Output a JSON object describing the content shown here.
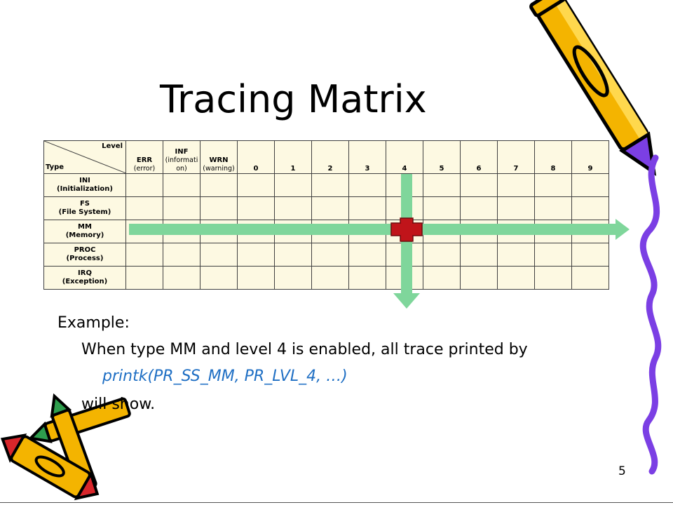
{
  "slide": {
    "title": "Tracing Matrix",
    "page_number": "5"
  },
  "matrix": {
    "corner_level": "Level",
    "corner_type": "Type",
    "columns": [
      {
        "main": "ERR",
        "sub": "(error)"
      },
      {
        "main": "INF",
        "sub": "(informati on)"
      },
      {
        "main": "WRN",
        "sub": "(warning)"
      },
      {
        "main": "0",
        "sub": ""
      },
      {
        "main": "1",
        "sub": ""
      },
      {
        "main": "2",
        "sub": ""
      },
      {
        "main": "3",
        "sub": ""
      },
      {
        "main": "4",
        "sub": ""
      },
      {
        "main": "5",
        "sub": ""
      },
      {
        "main": "6",
        "sub": ""
      },
      {
        "main": "7",
        "sub": ""
      },
      {
        "main": "8",
        "sub": ""
      },
      {
        "main": "9",
        "sub": ""
      }
    ],
    "rows": [
      {
        "main": "INI",
        "sub": "(Initialization)"
      },
      {
        "main": "FS",
        "sub": "(File System)"
      },
      {
        "main": "MM",
        "sub": "(Memory)"
      },
      {
        "main": "PROC",
        "sub": "(Process)"
      },
      {
        "main": "IRQ",
        "sub": "(Exception)"
      }
    ],
    "highlight": {
      "row": "MM",
      "column": "4"
    },
    "colors": {
      "cell_background": "#fdf9e2",
      "arrow": "#7fd69b",
      "cross": "#c0141a"
    }
  },
  "example": {
    "heading": "Example:",
    "line1": "When type MM and level 4 is enabled, all trace  printed by",
    "line2": "printk(PR_SS_MM, PR_LVL_4, …)",
    "line3": "will show."
  }
}
